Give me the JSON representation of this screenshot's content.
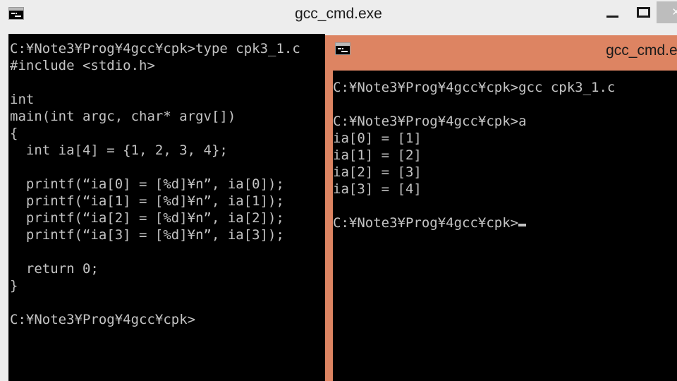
{
  "back_window": {
    "title": "gcc_cmd.exe",
    "icon_name": "console-icon",
    "controls": {
      "minimize_label": "—",
      "maximize_label": "□",
      "close_label": "×"
    },
    "terminal": {
      "lines": [
        "C:¥Note3¥Prog¥4gcc¥cpk>type cpk3_1.c",
        "#include <stdio.h>",
        "",
        "int",
        "main(int argc, char* argv[])",
        "{",
        "  int ia[4] = {1, 2, 3, 4};",
        "",
        "  printf(“ia[0] = [%d]¥n”, ia[0]);",
        "  printf(“ia[1] = [%d]¥n”, ia[1]);",
        "  printf(“ia[2] = [%d]¥n”, ia[2]);",
        "  printf(“ia[3] = [%d]¥n”, ia[3]);",
        "",
        "  return 0;",
        "}",
        "",
        "C:¥Note3¥Prog¥4gcc¥cpk>"
      ]
    }
  },
  "front_window": {
    "title": "gcc_cmd.exe",
    "icon_name": "console-icon",
    "titlebar_color": "#dd8462",
    "terminal": {
      "lines": [
        "C:¥Note3¥Prog¥4gcc¥cpk>gcc cpk3_1.c",
        "",
        "C:¥Note3¥Prog¥4gcc¥cpk>a",
        "ia[0] = [1]",
        "ia[1] = [2]",
        "ia[2] = [3]",
        "ia[3] = [4]",
        "",
        "C:¥Note3¥Prog¥4gcc¥cpk>"
      ],
      "cursor_after_last_line": true
    }
  },
  "colors": {
    "titlebar_inactive": "#ededed",
    "titlebar_active": "#dd8462",
    "terminal_bg": "#000000",
    "terminal_fg": "#c3c3c3",
    "close_button_hover": "#bdbdbd"
  }
}
